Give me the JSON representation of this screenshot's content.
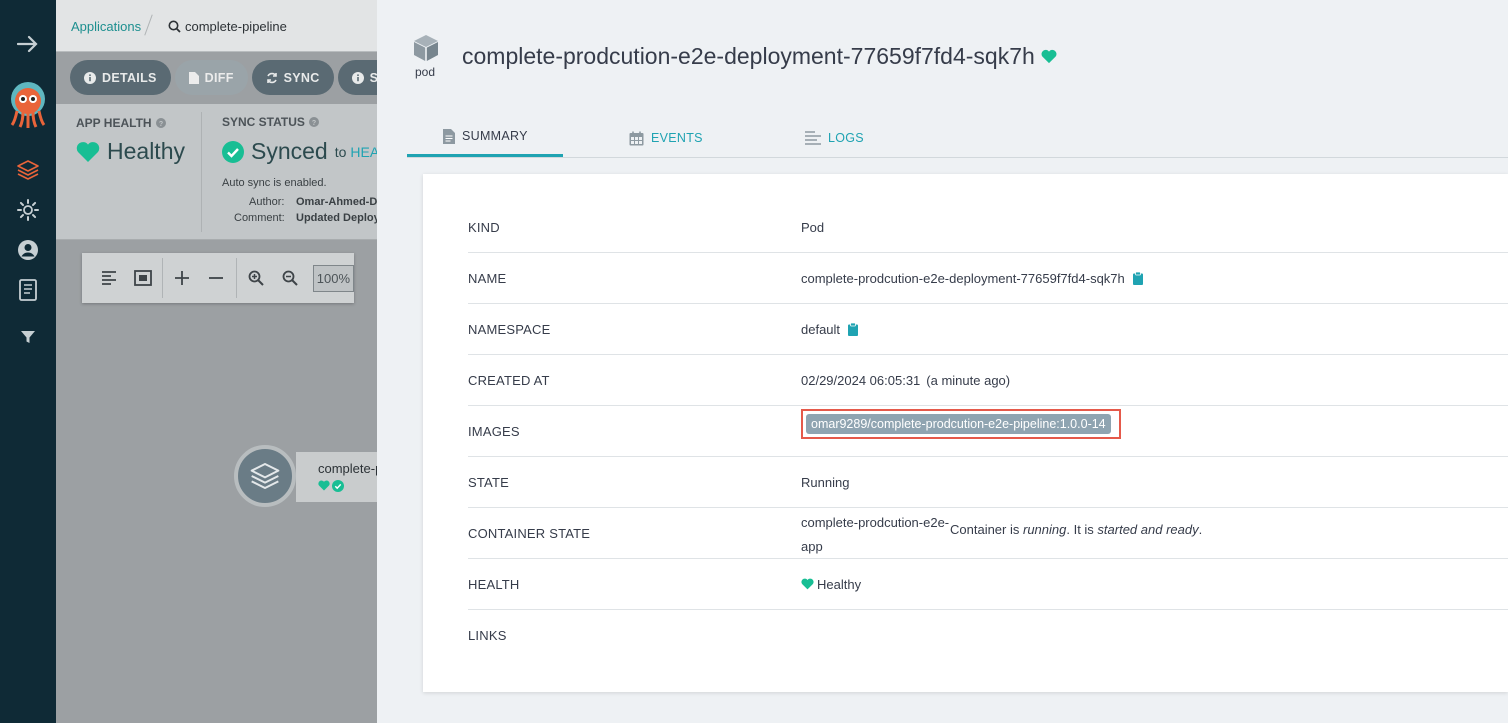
{
  "breadcrumb": {
    "applications": "Applications",
    "current": "complete-pipeline"
  },
  "toolbar": {
    "details": "DETAILS",
    "diff": "DIFF",
    "sync": "SYNC",
    "sync_status_partial": "SY"
  },
  "status": {
    "app_health_label": "APP HEALTH",
    "app_health_value": "Healthy",
    "sync_status_label": "SYNC STATUS",
    "sync_value": "Synced",
    "sync_to": "to",
    "sync_target_partial": "HEAI",
    "auto_sync": "Auto sync is enabled.",
    "author_label": "Author:",
    "author_value": "Omar-Ahmed-Dt",
    "comment_label": "Comment:",
    "comment_value": "Updated Deploym"
  },
  "graph_toolbar": {
    "zoom": "100%"
  },
  "graph_node": {
    "name_partial": "complete-p"
  },
  "panel": {
    "kind_icon_label": "pod",
    "title": "complete-prodcution-e2e-deployment-77659f7fd4-sqk7h",
    "tabs": [
      {
        "label": "SUMMARY"
      },
      {
        "label": "EVENTS"
      },
      {
        "label": "LOGS"
      }
    ],
    "summary": {
      "kind_label": "KIND",
      "kind_value": "Pod",
      "name_label": "NAME",
      "name_value": "complete-prodcution-e2e-deployment-77659f7fd4-sqk7h",
      "namespace_label": "NAMESPACE",
      "namespace_value": "default",
      "created_label": "CREATED AT",
      "created_value": "02/29/2024 06:05:31",
      "created_relative": "(a minute ago)",
      "images_label": "IMAGES",
      "images_value": "omar9289/complete-prodcution-e2e-pipeline:1.0.0-14",
      "state_label": "STATE",
      "state_value": "Running",
      "container_state_label": "CONTAINER STATE",
      "container_name": "complete-prodcution-e2e-app",
      "container_desc_1": "Container is ",
      "container_desc_2": "running",
      "container_desc_3": ". It is ",
      "container_desc_4": "started and ready",
      "container_desc_5": ".",
      "health_label": "HEALTH",
      "health_value": "Healthy",
      "links_label": "LINKS"
    }
  },
  "colors": {
    "accent": "#1fa3b2",
    "healthy": "#18be94",
    "highlight": "#e5594a",
    "nav": "#0f2a36"
  }
}
